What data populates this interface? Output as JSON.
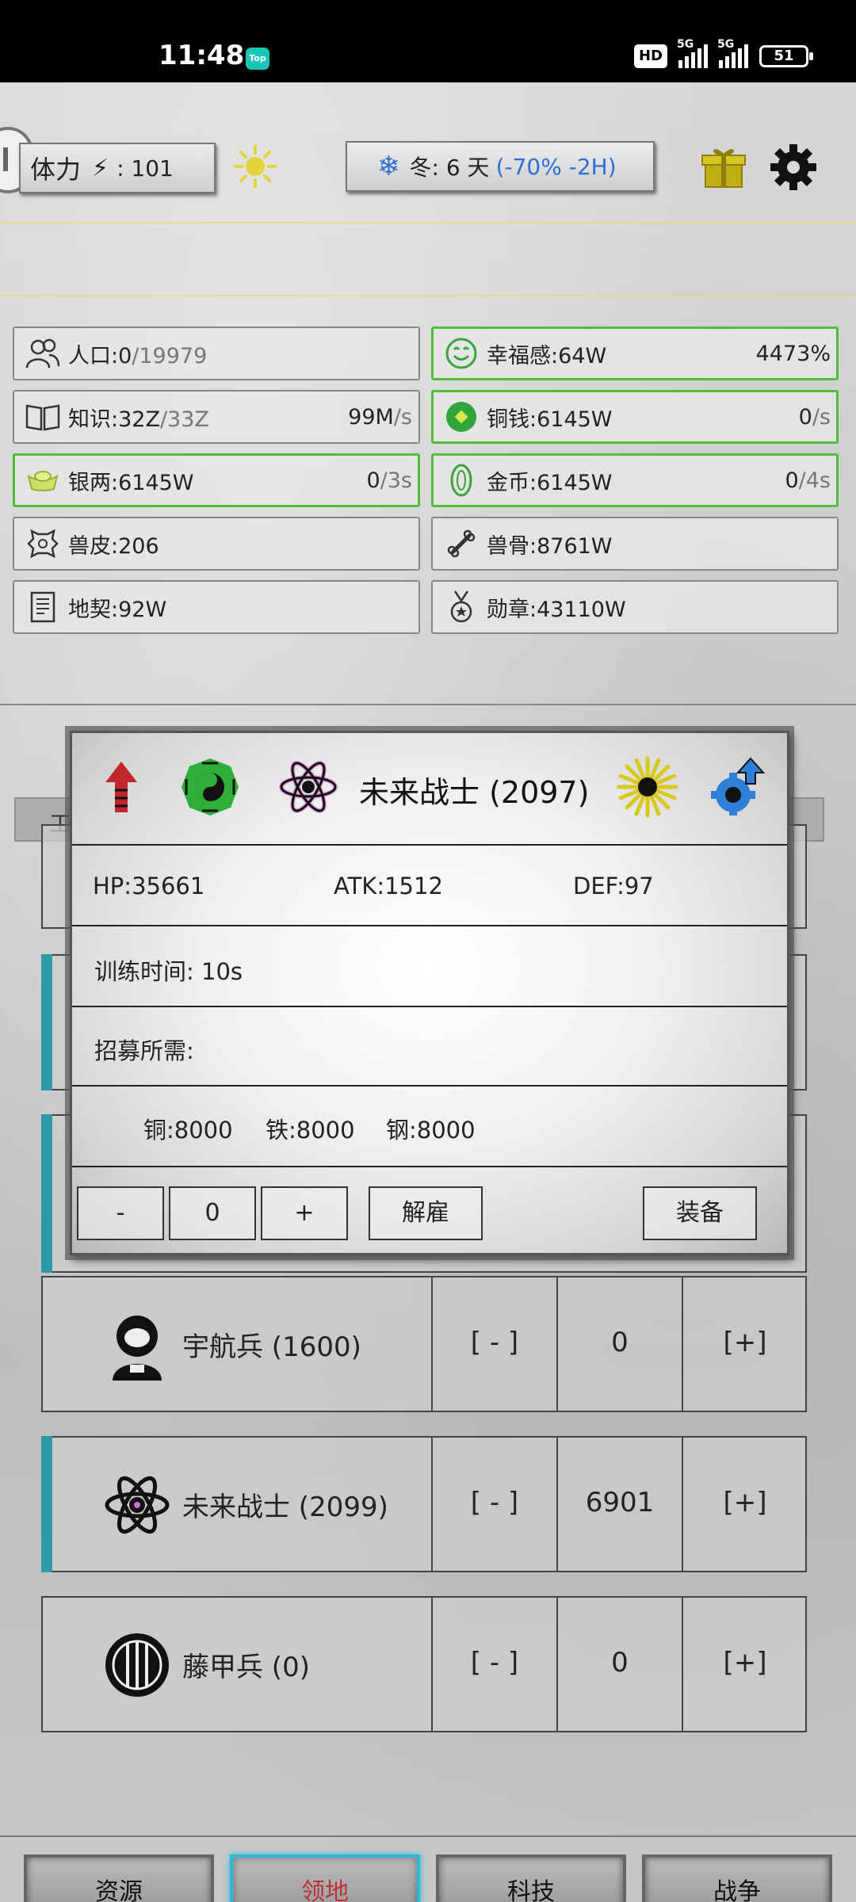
{
  "status_bar": {
    "time": "11:48",
    "app_badge": "Top",
    "hd": "HD",
    "network1": "5G",
    "network2": "5G",
    "battery": "51"
  },
  "top_bar": {
    "stamina_label": "体力",
    "stamina_value": ": 101",
    "season_label": "冬: 6 天",
    "season_modifier": "(-70% -2H)",
    "icons": [
      "sun-icon",
      "gift-icon",
      "gear-icon"
    ]
  },
  "resources": [
    {
      "name": "人口:0",
      "total": "/19979",
      "rate": "",
      "unit": "",
      "icon": "people-icon",
      "highlight": false
    },
    {
      "name": "幸福感:64W",
      "total": "",
      "rate": "4473%",
      "unit": "",
      "icon": "smile-icon",
      "highlight": true
    },
    {
      "name": "知识:32Z",
      "total": "/33Z",
      "rate": "99M",
      "unit": "/s",
      "icon": "book-icon",
      "highlight": false
    },
    {
      "name": "铜钱:6145W",
      "total": "",
      "rate": "0",
      "unit": "/s",
      "icon": "copper-coin-icon",
      "highlight": true
    },
    {
      "name": "银两:6145W",
      "total": "",
      "rate": "0",
      "unit": "/3s",
      "icon": "silver-ingot-icon",
      "highlight": true
    },
    {
      "name": "金币:6145W",
      "total": "",
      "rate": "0",
      "unit": "/4s",
      "icon": "gold-coin-icon",
      "highlight": true
    },
    {
      "name": "兽皮:206",
      "total": "",
      "rate": "",
      "unit": "",
      "icon": "hide-icon",
      "highlight": false
    },
    {
      "name": "兽骨:8761W",
      "total": "",
      "rate": "",
      "unit": "",
      "icon": "bone-icon",
      "highlight": false
    },
    {
      "name": "地契:92W",
      "total": "",
      "rate": "",
      "unit": "",
      "icon": "deed-icon",
      "highlight": false
    },
    {
      "name": "勋章:43110W",
      "total": "",
      "rate": "",
      "unit": "",
      "icon": "medal-icon",
      "highlight": false
    }
  ],
  "subtab_partial": "工",
  "units": [
    {
      "name": "宇航兵 (1600)",
      "minus": "[ - ]",
      "count": "0",
      "plus": "[+]",
      "icon": "astronaut-icon",
      "selected": false
    },
    {
      "name": "未来战士 (2099)",
      "minus": "[ - ]",
      "count": "6901",
      "plus": "[+]",
      "icon": "atom-flower-icon",
      "selected": true
    },
    {
      "name": "藤甲兵 (0)",
      "minus": "[ - ]",
      "count": "0",
      "plus": "[+]",
      "icon": "shield-icon",
      "selected": false
    }
  ],
  "nav": [
    {
      "label": "资源",
      "active": false
    },
    {
      "label": "领地",
      "active": true
    },
    {
      "label": "科技",
      "active": false
    },
    {
      "label": "战争",
      "active": false
    }
  ],
  "modal": {
    "title": "未来战士 (2097)",
    "header_icons": [
      "upgrade-arrow-icon",
      "bagua-icon",
      "atom-flower-icon",
      "sunburst-icon",
      "gear-upgrade-icon"
    ],
    "hp": "HP:35661",
    "atk": "ATK:1512",
    "def": "DEF:97",
    "training_time": "训练时间: 10s",
    "recruit_label": "招募所需:",
    "costs": [
      "铜:8000",
      "铁:8000",
      "钢:8000"
    ],
    "minus_label": "-",
    "quantity": "0",
    "plus_label": "+",
    "dismiss_label": "解雇",
    "equip_label": "装备"
  }
}
